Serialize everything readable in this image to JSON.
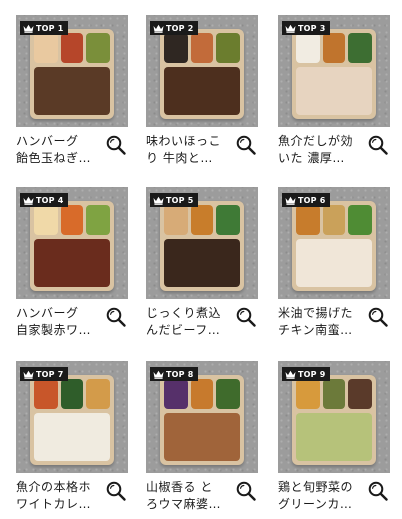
{
  "colors": {
    "badge_bg": "#1a1a1a",
    "badge_text": "#ffffff",
    "photo_bg": "#9c9c9c",
    "tray": "#d9c3a2"
  },
  "icons": {
    "badge": "crown-icon",
    "action": "search-icon"
  },
  "items": [
    {
      "rank": "TOP 1",
      "title_line1": "ハンバーグ",
      "title_line2": "飴色玉ねぎ…",
      "dish_colors": [
        "#5a3a26",
        "#e9c9a0",
        "#b6462a",
        "#7a8f3a"
      ]
    },
    {
      "rank": "TOP 2",
      "title_line1": "味わいほっこ",
      "title_line2": "り 牛肉と…",
      "dish_colors": [
        "#4d2f1e",
        "#2f2722",
        "#c26b3a",
        "#6b7d2e"
      ]
    },
    {
      "rank": "TOP 3",
      "title_line1": "魚介だしが効",
      "title_line2": "いた 濃厚…",
      "dish_colors": [
        "#e7d4c0",
        "#f1ece2",
        "#c0742d",
        "#3d6e32"
      ]
    },
    {
      "rank": "TOP 4",
      "title_line1": "ハンバーグ",
      "title_line2": "自家製赤ワ…",
      "dish_colors": [
        "#6a2c1d",
        "#f0d9a8",
        "#d86b2a",
        "#7fa342"
      ]
    },
    {
      "rank": "TOP 5",
      "title_line1": "じっくり煮込",
      "title_line2": "んだビーフ…",
      "dish_colors": [
        "#3a271c",
        "#d7ab77",
        "#c87d2b",
        "#3f7a36"
      ]
    },
    {
      "rank": "TOP 6",
      "title_line1": "米油で揚げた",
      "title_line2": "チキン南蛮…",
      "dish_colors": [
        "#f0e6d8",
        "#c77c2c",
        "#caa15a",
        "#4f8c34"
      ]
    },
    {
      "rank": "TOP 7",
      "title_line1": "魚介の本格ホ",
      "title_line2": "ワイトカレ…",
      "dish_colors": [
        "#f0ebe0",
        "#c8562a",
        "#2f5d2a",
        "#d39b4a"
      ]
    },
    {
      "rank": "TOP 8",
      "title_line1": "山椒香る と",
      "title_line2": "ろウマ麻婆…",
      "dish_colors": [
        "#a0643a",
        "#56306a",
        "#c77a2d",
        "#3f6b2c"
      ]
    },
    {
      "rank": "TOP 9",
      "title_line1": "鶏と旬野菜の",
      "title_line2": "グリーンカ…",
      "dish_colors": [
        "#b6c27a",
        "#d79a3c",
        "#6c7a3a",
        "#5a3a2a"
      ]
    }
  ]
}
